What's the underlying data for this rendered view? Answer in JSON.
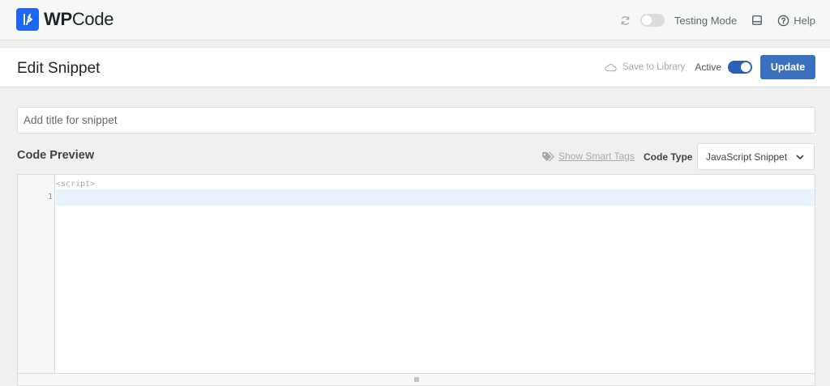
{
  "app": {
    "logo_text_bold": "WP",
    "logo_text_rest": "Code"
  },
  "topbar": {
    "testing_mode_label": "Testing Mode",
    "help_label": "Help",
    "testing_mode_on": false
  },
  "header": {
    "title": "Edit Snippet",
    "save_to_library": "Save to Library",
    "active_label": "Active",
    "active_on": true,
    "update_label": "Update"
  },
  "snippet": {
    "title_placeholder": "Add title for snippet",
    "title_value": ""
  },
  "code": {
    "section_label": "Code Preview",
    "smart_tags_label": "Show Smart Tags",
    "code_type_label": "Code Type",
    "code_type_value": "JavaScript Snippet",
    "pre_text": "<script>",
    "line_numbers": [
      "1"
    ]
  },
  "colors": {
    "brand": "#1b66f3",
    "primary_button": "#3b6fbf",
    "toggle_on": "#2d5fb8",
    "active_line": "#e8f2fe"
  }
}
